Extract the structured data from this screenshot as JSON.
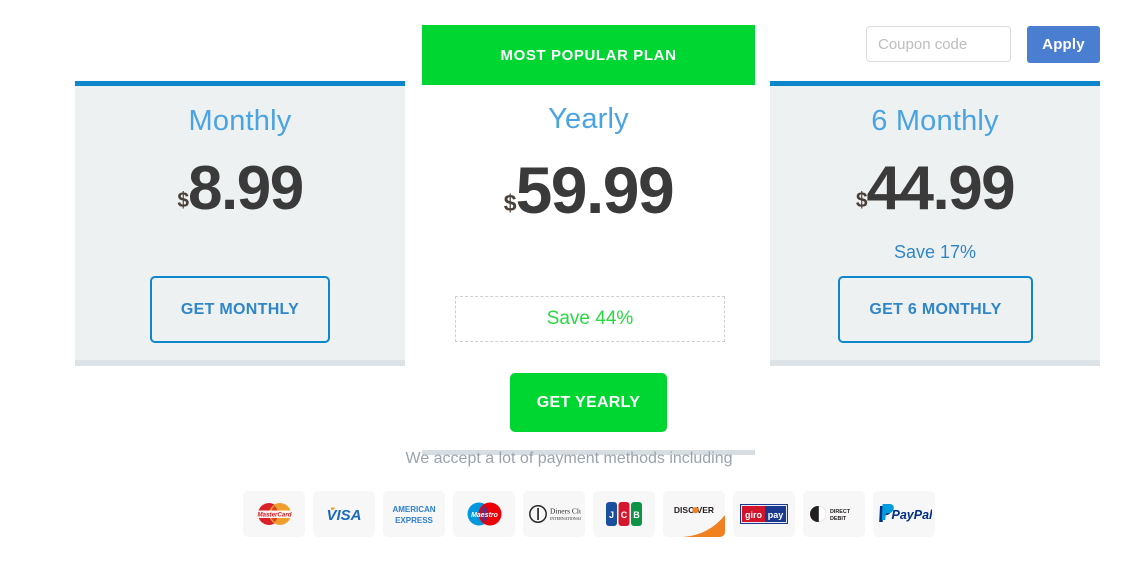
{
  "coupon": {
    "placeholder": "Coupon code",
    "value": "",
    "apply_label": "Apply"
  },
  "plans": [
    {
      "id": "monthly",
      "title": "Monthly",
      "currency": "$",
      "amount": "8.99",
      "save_label": "",
      "cta": "GET MONTHLY",
      "featured": false,
      "accent": "#0d86cc"
    },
    {
      "id": "yearly",
      "title": "Yearly",
      "currency": "$",
      "amount": "59.99",
      "save_label": "Save 44%",
      "cta": "GET YEARLY",
      "featured": true,
      "ribbon": "MOST POPULAR PLAN",
      "accent": "#00d632"
    },
    {
      "id": "six-monthly",
      "title": "6 Monthly",
      "currency": "$",
      "amount": "44.99",
      "save_label": "Save 17%",
      "cta": "GET 6 MONTHLY",
      "featured": false,
      "accent": "#0d86cc"
    }
  ],
  "payments": {
    "note": "We accept a lot of payment methods including",
    "methods": [
      "mastercard-icon",
      "visa-icon",
      "american-express-icon",
      "maestro-icon",
      "diners-club-icon",
      "jcb-icon",
      "discover-icon",
      "giropay-icon",
      "direct-debit-icon",
      "paypal-icon"
    ]
  },
  "colors": {
    "accent_blue": "#0d86cc",
    "title_blue": "#4aa3e2",
    "accent_green": "#00d632",
    "apply_blue": "#4a7ed0",
    "card_bg": "#eef1f2"
  }
}
